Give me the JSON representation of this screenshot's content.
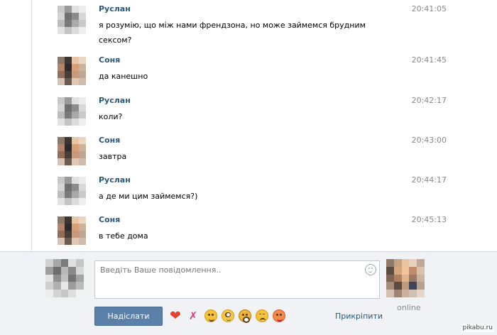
{
  "messages": [
    {
      "author": "Руслан",
      "time": "20:41:05",
      "lines": [
        "я розумію, що між нами френдзона, но може займемся брудним",
        "сексом?"
      ],
      "avatar": "ruslan"
    },
    {
      "author": "Соня",
      "time": "20:41:45",
      "lines": [
        "да канешно"
      ],
      "avatar": "sonya"
    },
    {
      "author": "Руслан",
      "time": "20:42:17",
      "lines": [
        "коли?"
      ],
      "avatar": "ruslan"
    },
    {
      "author": "Соня",
      "time": "20:43:00",
      "lines": [
        "завтра"
      ],
      "avatar": "sonya"
    },
    {
      "author": "Руслан",
      "time": "20:44:17",
      "lines": [
        "а де ми цим займемся?)"
      ],
      "avatar": "ruslan"
    },
    {
      "author": "Соня",
      "time": "20:45:13",
      "lines": [
        "в тебе дома"
      ],
      "avatar": "sonya"
    }
  ],
  "compose": {
    "placeholder": "Введіть Ваше повідомлення..",
    "send_label": "Надіслати",
    "attach_label": "Прикріпити",
    "status": "online",
    "emojis": [
      "heart-icon",
      "kiss-icon",
      "smile-icon",
      "flushed-icon",
      "scared-icon",
      "tired-icon",
      "tongue-icon"
    ]
  },
  "watermark": "pikabu.ru",
  "colors": {
    "author": "#2b587a",
    "time": "#8a8a8a",
    "send_button": "#5c81a8",
    "compose_bg": "#f0f2f5"
  },
  "avatars": {
    "ruslan": [
      "#c8c8c8",
      "#9a9a9a",
      "#e0e0e0",
      "#ececec",
      "#d4d4d4",
      "#707070",
      "#8c8c8c",
      "#d8d8d8",
      "#bdbdbd",
      "#7a7a7a",
      "#a9a9a9",
      "#c9c9c9",
      "#e2e2e2",
      "#c4c4c4",
      "#dcdcdc",
      "#eeeeee"
    ],
    "sonya": [
      "#8a7a6e",
      "#3e3530",
      "#e8c6a4",
      "#e9d7c4",
      "#b2846a",
      "#2f2a28",
      "#d9a074",
      "#cfb29a",
      "#8f6e5c",
      "#4a3d35",
      "#c89a7a",
      "#bfa592",
      "#d6c3b4",
      "#6b5a4f",
      "#e0c8b2",
      "#cdbbae"
    ],
    "compose_self": [
      "#d0d0d0",
      "#a8a8a8",
      "#7c7c7c",
      "#e0e0e0",
      "#c6c6c6",
      "#9e9e9e",
      "#6e6e6e",
      "#b8b8b8",
      "#8a8a8a",
      "#d8d8d8",
      "#e4e4e4",
      "#8f8f8f",
      "#c0c0c0",
      "#747474",
      "#a4a4a4",
      "#cfcfcf",
      "#b0b0b0",
      "#e8e8e8",
      "#9c9c9c",
      "#bcbcbc",
      "#ededed",
      "#d4d4d4",
      "#c8c8c8",
      "#dedede",
      "#f2f2f2"
    ],
    "compose_peer": [
      "#8f7a6a",
      "#c7a184",
      "#ecc3a0",
      "#e8d2bd",
      "#bfa896",
      "#5e4c42",
      "#d9a57c",
      "#f0c49c",
      "#c08e6c",
      "#d8c1ad",
      "#7c6555",
      "#b08060",
      "#e2b48e",
      "#9a7a66",
      "#c9b3a2",
      "#a78b79",
      "#5b4a40",
      "#c19a7e",
      "#3c4658",
      "#b9a190",
      "#d3c2b4",
      "#9e8676",
      "#cbb19c",
      "#cfc0b4",
      "#e4d6ca"
    ]
  }
}
